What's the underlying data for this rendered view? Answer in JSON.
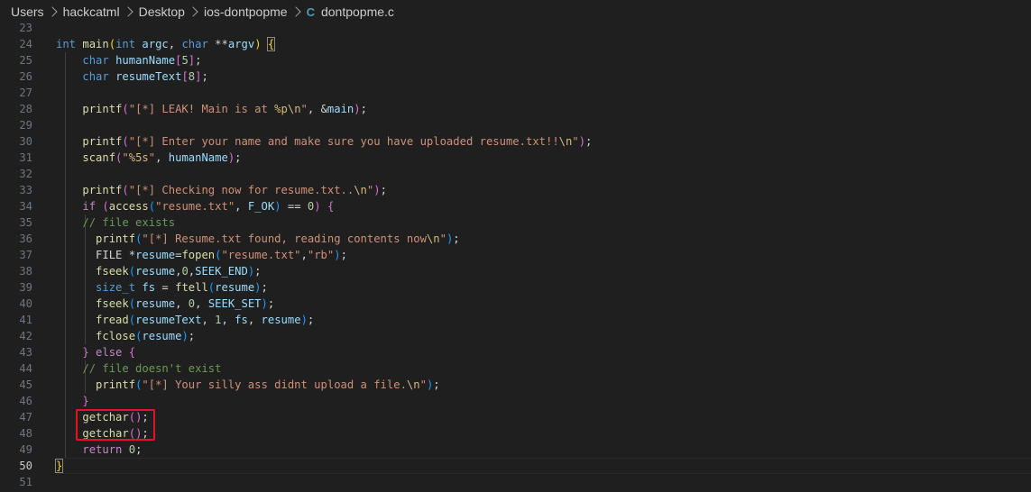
{
  "breadcrumb": {
    "items": [
      "Users",
      "hackcatml",
      "Desktop",
      "ios-dontpopme"
    ],
    "file_icon": "C",
    "file_name": "dontpopme.c"
  },
  "editor": {
    "active_line": 50,
    "highlight_color": "#e81123",
    "lines": [
      {
        "n": "23",
        "t": []
      },
      {
        "n": "24",
        "t": [
          [
            "kw",
            "int"
          ],
          [
            "pl",
            " "
          ],
          [
            "fn",
            "main"
          ],
          [
            "b1",
            "("
          ],
          [
            "kw",
            "int"
          ],
          [
            "pl",
            " "
          ],
          [
            "var",
            "argc"
          ],
          [
            "pl",
            ", "
          ],
          [
            "kw",
            "char"
          ],
          [
            "pl",
            " "
          ],
          [
            "op",
            "**"
          ],
          [
            "var",
            "argv"
          ],
          [
            "b1",
            ")"
          ],
          [
            "pl",
            " "
          ],
          [
            "b1box",
            "{"
          ]
        ]
      },
      {
        "n": "25",
        "t": [
          [
            "pl",
            "    "
          ],
          [
            "kw",
            "char"
          ],
          [
            "pl",
            " "
          ],
          [
            "var",
            "humanName"
          ],
          [
            "b2",
            "["
          ],
          [
            "num",
            "5"
          ],
          [
            "b2",
            "]"
          ],
          [
            "pl",
            ";"
          ]
        ]
      },
      {
        "n": "26",
        "t": [
          [
            "pl",
            "    "
          ],
          [
            "kw",
            "char"
          ],
          [
            "pl",
            " "
          ],
          [
            "var",
            "resumeText"
          ],
          [
            "b2",
            "["
          ],
          [
            "num",
            "8"
          ],
          [
            "b2",
            "]"
          ],
          [
            "pl",
            ";"
          ]
        ]
      },
      {
        "n": "27",
        "t": []
      },
      {
        "n": "28",
        "t": [
          [
            "pl",
            "    "
          ],
          [
            "fn",
            "printf"
          ],
          [
            "b2",
            "("
          ],
          [
            "str",
            "\"[*] LEAK! Main is at "
          ],
          [
            "esc",
            "%p"
          ],
          [
            "esc",
            "\\n"
          ],
          [
            "str",
            "\""
          ],
          [
            "pl",
            ", &"
          ],
          [
            "var",
            "main"
          ],
          [
            "b2",
            ")"
          ],
          [
            "pl",
            ";"
          ]
        ]
      },
      {
        "n": "29",
        "t": []
      },
      {
        "n": "30",
        "t": [
          [
            "pl",
            "    "
          ],
          [
            "fn",
            "printf"
          ],
          [
            "b2",
            "("
          ],
          [
            "str",
            "\"[*] Enter your name and make sure you have uploaded resume.txt!!"
          ],
          [
            "esc",
            "\\n"
          ],
          [
            "str",
            "\""
          ],
          [
            "b2",
            ")"
          ],
          [
            "pl",
            ";"
          ]
        ]
      },
      {
        "n": "31",
        "t": [
          [
            "pl",
            "    "
          ],
          [
            "fn",
            "scanf"
          ],
          [
            "b2",
            "("
          ],
          [
            "str",
            "\""
          ],
          [
            "esc",
            "%5s"
          ],
          [
            "str",
            "\""
          ],
          [
            "pl",
            ", "
          ],
          [
            "var",
            "humanName"
          ],
          [
            "b2",
            ")"
          ],
          [
            "pl",
            ";"
          ]
        ]
      },
      {
        "n": "32",
        "t": []
      },
      {
        "n": "33",
        "t": [
          [
            "pl",
            "    "
          ],
          [
            "fn",
            "printf"
          ],
          [
            "b2",
            "("
          ],
          [
            "str",
            "\"[*] Checking now for resume.txt.."
          ],
          [
            "esc",
            "\\n"
          ],
          [
            "str",
            "\""
          ],
          [
            "b2",
            ")"
          ],
          [
            "pl",
            ";"
          ]
        ]
      },
      {
        "n": "34",
        "t": [
          [
            "pl",
            "    "
          ],
          [
            "ctl",
            "if"
          ],
          [
            "pl",
            " "
          ],
          [
            "b2",
            "("
          ],
          [
            "fn",
            "access"
          ],
          [
            "b3",
            "("
          ],
          [
            "str",
            "\"resume.txt\""
          ],
          [
            "pl",
            ", "
          ],
          [
            "var",
            "F_OK"
          ],
          [
            "b3",
            ")"
          ],
          [
            "pl",
            " == "
          ],
          [
            "num",
            "0"
          ],
          [
            "b2",
            ")"
          ],
          [
            "pl",
            " "
          ],
          [
            "b2",
            "{"
          ]
        ]
      },
      {
        "n": "35",
        "t": [
          [
            "pl",
            "    "
          ],
          [
            "cm",
            "// file exists"
          ]
        ]
      },
      {
        "n": "36",
        "t": [
          [
            "pl",
            "      "
          ],
          [
            "fn",
            "printf"
          ],
          [
            "b3",
            "("
          ],
          [
            "str",
            "\"[*] Resume.txt found, reading contents now"
          ],
          [
            "esc",
            "\\n"
          ],
          [
            "str",
            "\""
          ],
          [
            "b3",
            ")"
          ],
          [
            "pl",
            ";"
          ]
        ]
      },
      {
        "n": "37",
        "t": [
          [
            "pl",
            "      FILE *"
          ],
          [
            "var",
            "resume"
          ],
          [
            "pl",
            "="
          ],
          [
            "fn",
            "fopen"
          ],
          [
            "b3",
            "("
          ],
          [
            "str",
            "\"resume.txt\""
          ],
          [
            "pl",
            ","
          ],
          [
            "str",
            "\"rb\""
          ],
          [
            "b3",
            ")"
          ],
          [
            "pl",
            ";"
          ]
        ]
      },
      {
        "n": "38",
        "t": [
          [
            "pl",
            "      "
          ],
          [
            "fn",
            "fseek"
          ],
          [
            "b3",
            "("
          ],
          [
            "var",
            "resume"
          ],
          [
            "pl",
            ","
          ],
          [
            "num",
            "0"
          ],
          [
            "pl",
            ","
          ],
          [
            "var",
            "SEEK_END"
          ],
          [
            "b3",
            ")"
          ],
          [
            "pl",
            ";"
          ]
        ]
      },
      {
        "n": "39",
        "t": [
          [
            "pl",
            "      "
          ],
          [
            "kw",
            "size_t"
          ],
          [
            "pl",
            " "
          ],
          [
            "var",
            "fs"
          ],
          [
            "pl",
            " = "
          ],
          [
            "fn",
            "ftell"
          ],
          [
            "b3",
            "("
          ],
          [
            "var",
            "resume"
          ],
          [
            "b3",
            ")"
          ],
          [
            "pl",
            ";"
          ]
        ]
      },
      {
        "n": "40",
        "t": [
          [
            "pl",
            "      "
          ],
          [
            "fn",
            "fseek"
          ],
          [
            "b3",
            "("
          ],
          [
            "var",
            "resume"
          ],
          [
            "pl",
            ", "
          ],
          [
            "num",
            "0"
          ],
          [
            "pl",
            ", "
          ],
          [
            "var",
            "SEEK_SET"
          ],
          [
            "b3",
            ")"
          ],
          [
            "pl",
            ";"
          ]
        ]
      },
      {
        "n": "41",
        "t": [
          [
            "pl",
            "      "
          ],
          [
            "fn",
            "fread"
          ],
          [
            "b3",
            "("
          ],
          [
            "var",
            "resumeText"
          ],
          [
            "pl",
            ", "
          ],
          [
            "num",
            "1"
          ],
          [
            "pl",
            ", "
          ],
          [
            "var",
            "fs"
          ],
          [
            "pl",
            ", "
          ],
          [
            "var",
            "resume"
          ],
          [
            "b3",
            ")"
          ],
          [
            "pl",
            ";"
          ]
        ]
      },
      {
        "n": "42",
        "t": [
          [
            "pl",
            "      "
          ],
          [
            "fn",
            "fclose"
          ],
          [
            "b3",
            "("
          ],
          [
            "var",
            "resume"
          ],
          [
            "b3",
            ")"
          ],
          [
            "pl",
            ";"
          ]
        ]
      },
      {
        "n": "43",
        "t": [
          [
            "pl",
            "    "
          ],
          [
            "b2",
            "}"
          ],
          [
            "pl",
            " "
          ],
          [
            "ctl",
            "else"
          ],
          [
            "pl",
            " "
          ],
          [
            "b2",
            "{"
          ]
        ]
      },
      {
        "n": "44",
        "t": [
          [
            "pl",
            "    "
          ],
          [
            "cm",
            "// file doesn't exist"
          ]
        ]
      },
      {
        "n": "45",
        "t": [
          [
            "pl",
            "      "
          ],
          [
            "fn",
            "printf"
          ],
          [
            "b3",
            "("
          ],
          [
            "str",
            "\"[*] Your silly ass didnt upload a file."
          ],
          [
            "esc",
            "\\n"
          ],
          [
            "str",
            "\""
          ],
          [
            "b3",
            ")"
          ],
          [
            "pl",
            ";"
          ]
        ]
      },
      {
        "n": "46",
        "t": [
          [
            "pl",
            "    "
          ],
          [
            "b2",
            "}"
          ]
        ]
      },
      {
        "n": "47",
        "t": [
          [
            "pl",
            "    "
          ],
          [
            "fn",
            "getchar"
          ],
          [
            "b2",
            "()"
          ],
          [
            "pl",
            ";"
          ]
        ]
      },
      {
        "n": "48",
        "t": [
          [
            "pl",
            "    "
          ],
          [
            "fn",
            "getchar"
          ],
          [
            "b2",
            "()"
          ],
          [
            "pl",
            ";"
          ]
        ]
      },
      {
        "n": "49",
        "t": [
          [
            "pl",
            "    "
          ],
          [
            "ctl",
            "return"
          ],
          [
            "pl",
            " "
          ],
          [
            "num",
            "0"
          ],
          [
            "pl",
            ";"
          ]
        ]
      },
      {
        "n": "50",
        "t": [
          [
            "b1box",
            "}"
          ]
        ]
      },
      {
        "n": "51",
        "t": []
      }
    ]
  }
}
